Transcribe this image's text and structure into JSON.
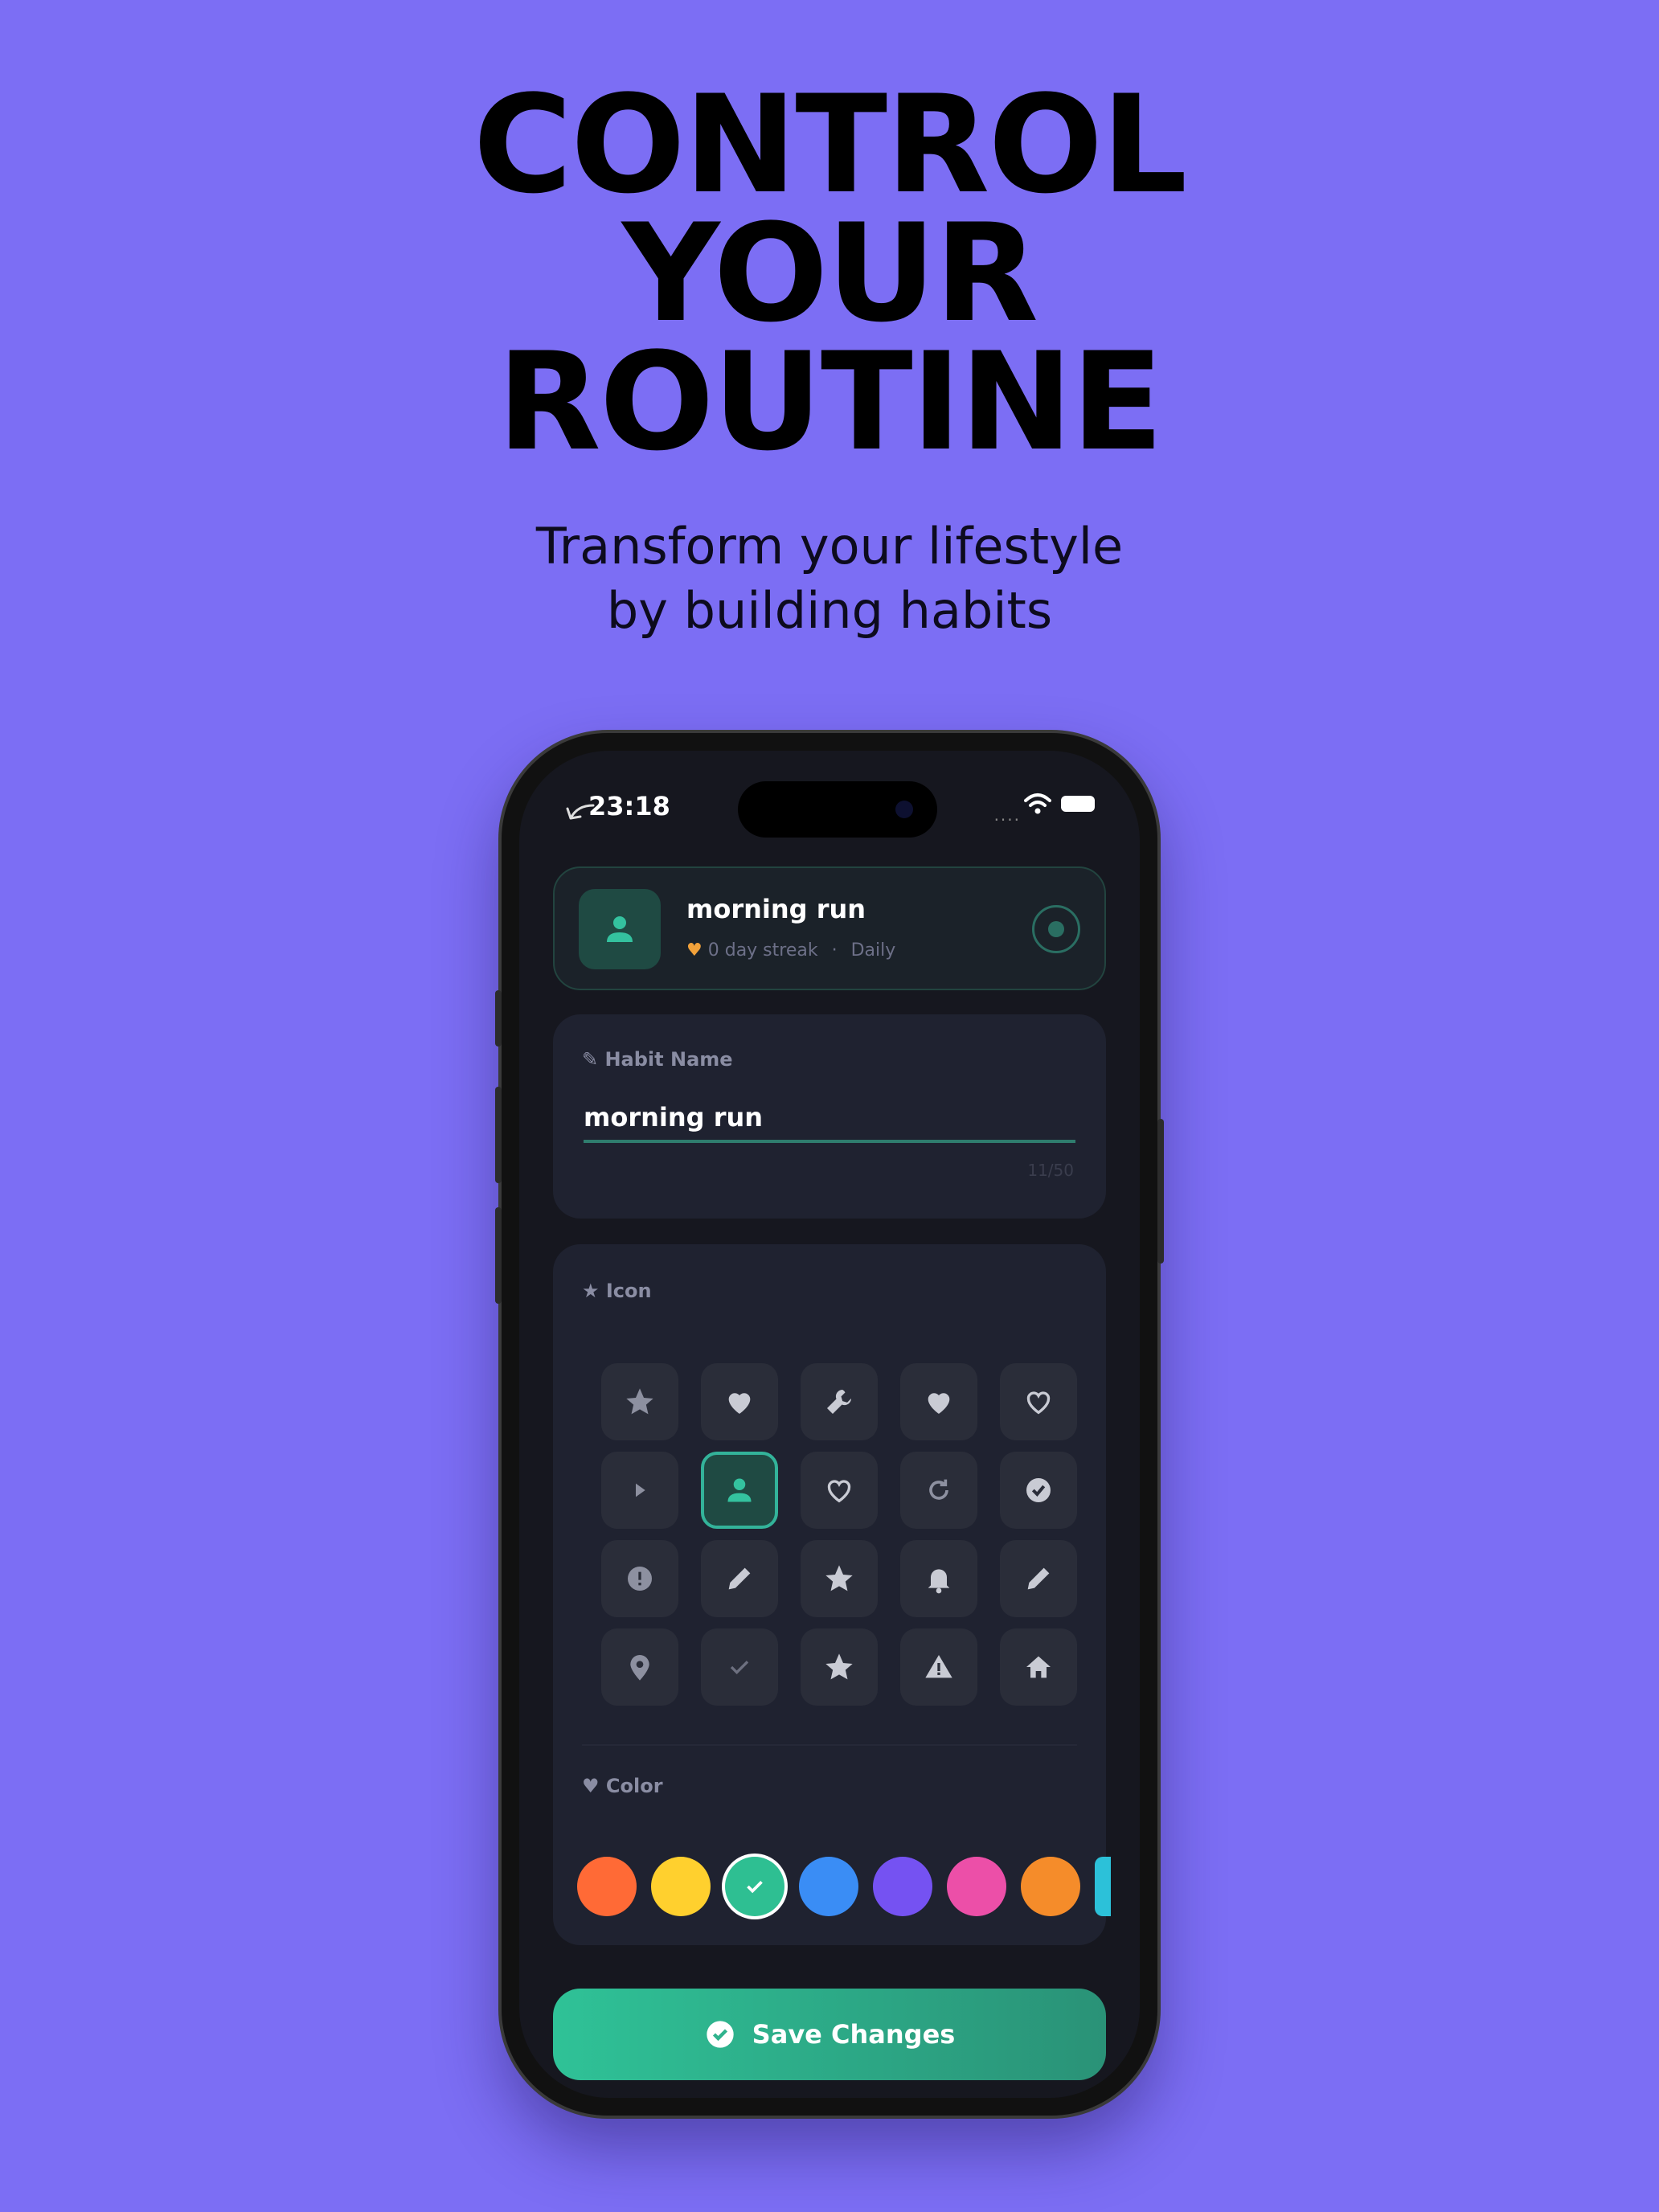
{
  "promo": {
    "headline": [
      "CONTROL",
      "YOUR",
      "ROUTINE"
    ],
    "subtitle": [
      "Transform your lifestyle",
      "by building habits"
    ]
  },
  "status_bar": {
    "time": "23:18",
    "signal_text": "...."
  },
  "habit": {
    "title": "morning run",
    "streak": "0 day streak",
    "separator": "·",
    "frequency": "Daily",
    "icon": "person-icon"
  },
  "name_section": {
    "label": "Habit Name",
    "value": "morning run",
    "counter": "11/50"
  },
  "icon_section": {
    "label": "Icon",
    "icons": [
      "star-icon",
      "heart-icon",
      "wrench-icon",
      "heart-icon",
      "heart-outline-icon",
      "play-icon",
      "person-icon",
      "heart-outline-icon",
      "refresh-icon",
      "check-circle-icon",
      "info-icon",
      "pencil-icon",
      "star-icon",
      "bell-icon",
      "pencil-icon",
      "location-pin-icon",
      "check-icon",
      "star-icon",
      "warning-icon",
      "home-icon"
    ],
    "selected_index": 6
  },
  "color_section": {
    "label": "Color",
    "colors": [
      "#ff6a36",
      "#ffd02e",
      "#2ebf92",
      "#3a8df5",
      "#7552f2",
      "#ec4fa8",
      "#f58c2a",
      "#2cc1d9"
    ],
    "selected_index": 2
  },
  "save_button": {
    "label": "Save Changes"
  },
  "theme": {
    "accent": "#2ebf92",
    "background": "#7c6ef4",
    "card": "#1f2230"
  }
}
